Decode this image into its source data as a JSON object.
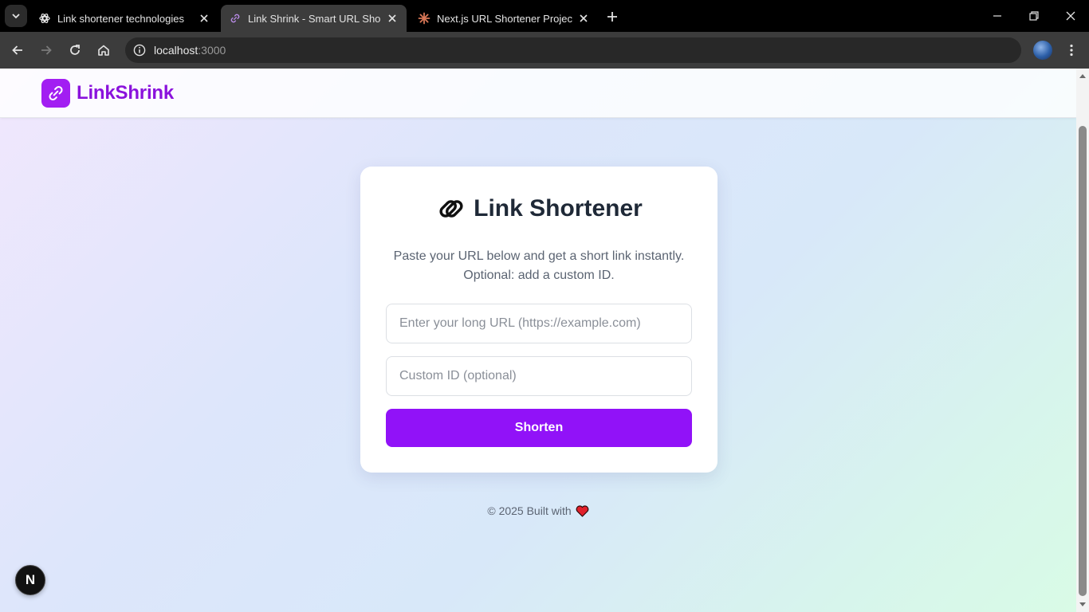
{
  "browser": {
    "tabs": [
      {
        "title": "Link shortener technologies",
        "icon": "openai-icon",
        "active": false
      },
      {
        "title": "Link Shrink - Smart URL Shortener",
        "icon": "link-icon",
        "active": true
      },
      {
        "title": "Next.js URL Shortener Project -",
        "icon": "claude-icon",
        "active": false
      }
    ],
    "address": {
      "host": "localhost",
      "port": ":3000"
    },
    "colors": {
      "tabbar": "#000000",
      "toolbar": "#3c3c3c"
    }
  },
  "header": {
    "logo_text": "LinkShrink",
    "logo_icon": "link-icon"
  },
  "card": {
    "title": "Link Shortener",
    "title_icon": "paperclip-icon",
    "description": "Paste your URL below and get a short link instantly. Optional: add a custom ID.",
    "url_input": {
      "placeholder": "Enter your long URL (https://example.com)",
      "value": ""
    },
    "custom_input": {
      "placeholder": "Custom ID (optional)",
      "value": ""
    },
    "submit_label": "Shorten"
  },
  "footer": {
    "text": "© 2025 Built with",
    "icon": "heart-icon"
  },
  "dev_badge": {
    "label": "N"
  },
  "colors": {
    "brand": "#8a12dc",
    "button": "#9112f8",
    "logo_bg": "#a21ef2",
    "heart": "#e0202b"
  }
}
